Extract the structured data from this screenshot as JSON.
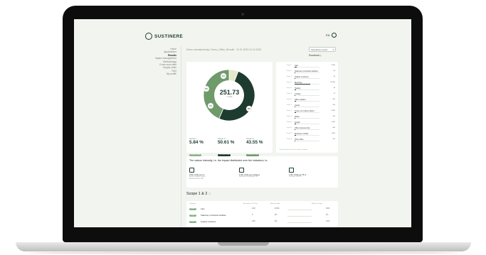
{
  "app": {
    "logo_text": "SUSTINERE",
    "lang": "EN"
  },
  "sidebar": {
    "items": [
      {
        "label": "Home",
        "active": false
      },
      {
        "label": "Applications",
        "active": false
      },
      {
        "label": "Results",
        "active": true
      },
      {
        "label": "Impact management",
        "active": false
      },
      {
        "label": "Methodology",
        "active": false
      },
      {
        "label": "Cross scan data",
        "active": false
      },
      {
        "label": "Supply chain",
        "active": false
      },
      {
        "label": "FAQ",
        "active": false
      },
      {
        "label": "My profile",
        "active": false
      }
    ]
  },
  "header": {
    "breadcrumb": "Demo manufacturing / Demo_Office_Results · 31.01.2023-31.12.2023",
    "select_value": "Operations report",
    "download_label": "Download"
  },
  "donut": {
    "center_value": "251.73",
    "center_unit": "t CO2e",
    "segments": [
      {
        "label": "Scope 1",
        "pct": 5.84,
        "color": "#e6e7c9"
      },
      {
        "label": "Scope 2",
        "pct": 50.61,
        "color": "#1d3b2f"
      },
      {
        "label": "Scope 3",
        "pct": 43.55,
        "color": "#6f9a6a"
      }
    ],
    "slice_labels": [
      "16%",
      "48%",
      "31%",
      "5%"
    ],
    "scopes": [
      {
        "label": "Scope 1",
        "value": "5.84 %",
        "pill": "14.69 t CO2e",
        "pill_color": "#8bb38a"
      },
      {
        "label": "Scope 2",
        "value": "50.61 %",
        "pill": "127.41 t CO2e",
        "pill_color": "#1d3b2f"
      },
      {
        "label": "Scope 3",
        "value": "43.55 %",
        "pill": "109.63 t CO2e",
        "pill_color": "#6f9a6a"
      }
    ]
  },
  "bars": {
    "rows": [
      {
        "group": "Scope 1",
        "name": "Cars",
        "fill": 0.08,
        "value": "2,000"
      },
      {
        "group": "Scope 1",
        "name": "Stationary combustion facilities",
        "fill": 0.04,
        "value": "95"
      },
      {
        "group": "Scope 1",
        "name": "Fugitive emissions",
        "fill": 0.03,
        "value": "35"
      },
      {
        "group": "Scope 2",
        "name": "Electricity",
        "fill": 0.62,
        "value": "20,000"
      },
      {
        "group": "Scope 2",
        "name": "Heating",
        "fill": 0.05,
        "value": "18"
      },
      {
        "group": "Scope 2",
        "name": "Cooling",
        "fill": 0.04,
        "value": "12"
      },
      {
        "group": "Scope 3",
        "name": "Office supplies",
        "fill": 0.05,
        "value": "500"
      },
      {
        "group": "Scope 3",
        "name": "Assets",
        "fill": 0.04,
        "value": "310"
      },
      {
        "group": "Scope 3",
        "name": "Scope 1+2 indirect effects",
        "fill": 0.06,
        "value": "4,500"
      },
      {
        "group": "Scope 3",
        "name": "Waste",
        "fill": 0.03,
        "value": "140"
      },
      {
        "group": "Scope 3",
        "name": "Freight",
        "fill": 0.05,
        "value": "1,200"
      },
      {
        "group": "Scope 3",
        "name": "Office business trips",
        "fill": 0.04,
        "value": "300"
      },
      {
        "group": "Scope 3",
        "name": "Employee mobility",
        "fill": 0.06,
        "value": "1,900"
      },
      {
        "group": "Scope 3",
        "name": "Home office",
        "fill": 0.03,
        "value": "120"
      }
    ],
    "footnote": "* Emissions deduct offset or carbon removals"
  },
  "impact": {
    "title": "The carbon intensity, i.e. the impact distributed over the indicators, is:",
    "items": [
      {
        "line1": "9.59 t CO2e per m²",
        "line2": "Area in square metres",
        "line3": "Business area: 150"
      },
      {
        "line1": "4.45 t CO2e per employee",
        "line2": "Number of employees: 56",
        "line3": ""
      },
      {
        "line1": "1.36 t CO2e per T€ of",
        "line2": "Turnover: 184 T€",
        "line3": ""
      }
    ]
  },
  "scope12": {
    "title": "Scope 1 & 2",
    "headers": [
      "Category",
      "Emissions t CO2 eq",
      "Share of total",
      "Share of scope"
    ],
    "rows": [
      {
        "tag": "Scope 1",
        "name": "Cars",
        "v1": "4.69",
        "v2": "18.6%",
        "v3": "3.6%"
      },
      {
        "tag": "Scope 1",
        "name": "Stationary combustion facilities",
        "v1": "5",
        "v2": "2%",
        "v3": "1%"
      },
      {
        "tag": "Scope 1",
        "name": "Fugitive emissions",
        "v1": "0.05",
        "v2": "0%",
        "v3": "0.1%"
      }
    ]
  }
}
